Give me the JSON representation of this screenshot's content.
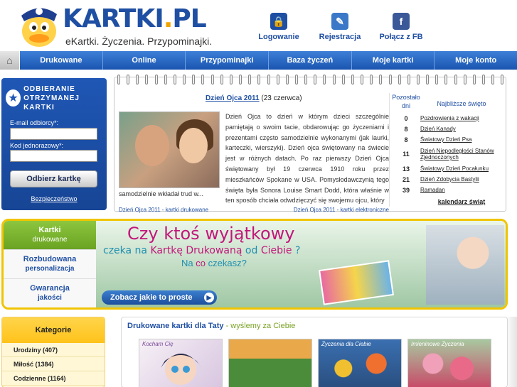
{
  "brand": {
    "logo_main": "KARTKI",
    "logo_dot": ".",
    "logo_tld": "PL",
    "tagline": "eKartki. Życzenia. Przypominajki."
  },
  "header_nav": [
    {
      "label": "Logowanie",
      "icon": "lock-icon",
      "color": "#1f4fa3"
    },
    {
      "label": "Rejestracja",
      "icon": "form-icon",
      "color": "#3b78c8"
    },
    {
      "label": "Połącz z FB",
      "icon": "facebook-icon",
      "color": "#3b5998"
    }
  ],
  "main_nav": [
    "Drukowane",
    "Online",
    "Przypominajki",
    "Baza życzeń",
    "Moje kartki",
    "Moje konto"
  ],
  "login": {
    "title_line1": "ODBIERANIE",
    "title_line2": "OTRZYMANEJ KARTKI",
    "email_label": "E-mail odbiorcy*:",
    "code_label": "Kod jednorazowy*:",
    "email_value": "",
    "code_value": "",
    "button": "Odbierz kartkę",
    "security_link": "Bezpieczeństwo"
  },
  "article": {
    "title": "Dzień Ojca 2011",
    "date": "(23 czerwca)",
    "body": "Dzień Ojca to dzień w którym dzieci szczególnie pamiętają o swoim tacie, obdarowując go życzeniami i prezentami często samodzielnie wykonanymi (jak laurki, karteczki, wierszyki). Dzień ojca świętowany na świecie jest w różnych datach. Po raz pierwszy Dzień Ojca świętowany był 19 czerwca 1910 roku przez mieszkańców Spokane w USA. Pomysłodawczynią tego święta była Sonora Louise Smart Dodd, która właśnie w ten sposób chciała odwdzięczyć się swojemu ojcu, który",
    "body_continued": "samodzielnie wkładał trud w...",
    "link_printed": "Dzień Ojca 2011 - kartki drukowane",
    "link_electronic": "Dzień Ojca 2011 - kartki elektroniczne"
  },
  "holidays": {
    "col_days": "Pozostało dni",
    "col_name": "Najbliższe święto",
    "rows": [
      {
        "days": "0",
        "name": "Pozdrowienia z wakacji"
      },
      {
        "days": "8",
        "name": "Dzień Kanady"
      },
      {
        "days": "8",
        "name": "Światowy Dzień Psa"
      },
      {
        "days": "11",
        "name": "Dzień Niepodległości Stanów Zjednoczonych"
      },
      {
        "days": "13",
        "name": "Światowy Dzień Pocałunku"
      },
      {
        "days": "21",
        "name": "Dzień Zdobycia Bastylii"
      },
      {
        "days": "39",
        "name": "Ramadan"
      }
    ],
    "calendar_link": "kalendarz świąt"
  },
  "promo": {
    "side_items": [
      {
        "line1": "Kartki",
        "line2": "drukowane",
        "active": true
      },
      {
        "line1": "Rozbudowana",
        "line2": "personalizacja",
        "active": false
      },
      {
        "line1": "Gwarancja",
        "line2": "jakości",
        "active": false
      }
    ],
    "headline1": "Czy ktoś wyjątkowy",
    "headline2_pre": "czeka na",
    "headline2_hl": "Kartkę Drukowaną",
    "headline2_mid": "od",
    "headline2_hl2": "Ciebie",
    "headline2_post": "?",
    "headline3_pre": "Na",
    "headline3_hl": "co",
    "headline3_post": "czekasz?",
    "cta": "Zobacz jakie to proste"
  },
  "categories": {
    "title": "Kategorie",
    "items": [
      "Urodziny (407)",
      "Miłość (1384)",
      "Codzienne (1164)"
    ]
  },
  "printed_cards": {
    "title": "Drukowane kartki dla Taty",
    "subtitle": "- wyślemy za Ciebie",
    "thumbs": [
      {
        "caption": "Kocham Cię",
        "color1": "#f6f0f6",
        "color2": "#d8c6e0"
      },
      {
        "caption": "",
        "color1": "#e9a84a",
        "color2": "#4a8c3a"
      },
      {
        "caption": "Życzenia dla Ciebie",
        "color1": "#3a6fb0",
        "color2": "#f0c030"
      },
      {
        "caption": "Imieninowe Życzenia",
        "color1": "#f0a0b8",
        "color2": "#c84a68"
      }
    ]
  }
}
